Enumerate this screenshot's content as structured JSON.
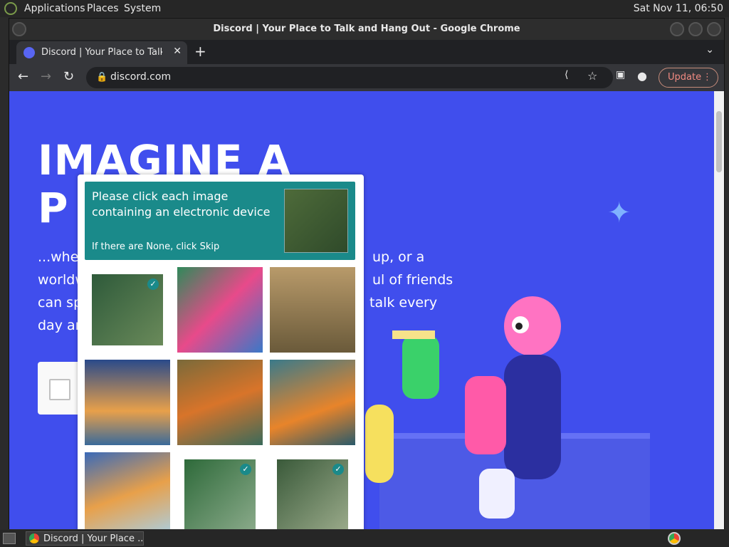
{
  "system": {
    "menu": [
      "Applications",
      "Places",
      "System"
    ],
    "clock": "Sat Nov 11, 06:50"
  },
  "browser": {
    "window_title": "Discord | Your Place to Talk and Hang Out - Google Chrome",
    "tab_title": "Discord | Your Place to Talk and Hang Out",
    "url": "discord.com",
    "update_label": "Update",
    "icons": [
      "back-icon",
      "forward-icon",
      "reload-icon",
      "lock-icon",
      "share-icon",
      "star-icon",
      "side-panel-icon",
      "profile-icon",
      "menu-icon"
    ]
  },
  "page": {
    "hero_line1": "IMAGINE A",
    "hero_line2": "P",
    "desc_line1_left": "...wher",
    "desc_line1_right": "up, or a",
    "desc_line2_left": "worldw",
    "desc_line2_right": "ul of friends",
    "desc_line3_left": "can sp",
    "desc_line3_right": "talk every",
    "desc_line4_left": "day an"
  },
  "captcha": {
    "prompt": "Please click each image containing an electronic device",
    "sub": "If there are None, click Skip",
    "tiles": [
      {
        "subject": "circuit board",
        "checked": true
      },
      {
        "subject": "hummingbird painting",
        "checked": false
      },
      {
        "subject": "forklift",
        "checked": false
      },
      {
        "subject": "goldfish painting",
        "checked": false
      },
      {
        "subject": "goldfish painting",
        "checked": false
      },
      {
        "subject": "goldfish painting",
        "checked": false
      },
      {
        "subject": "goldfish painting",
        "checked": false
      },
      {
        "subject": "circuit board",
        "checked": true
      },
      {
        "subject": "circuit board",
        "checked": true
      }
    ]
  },
  "taskbar": {
    "task_label": "Discord | Your Place ..."
  },
  "colors": {
    "discord_blurple": "#404eed",
    "captcha_teal": "#1a8a8a"
  }
}
